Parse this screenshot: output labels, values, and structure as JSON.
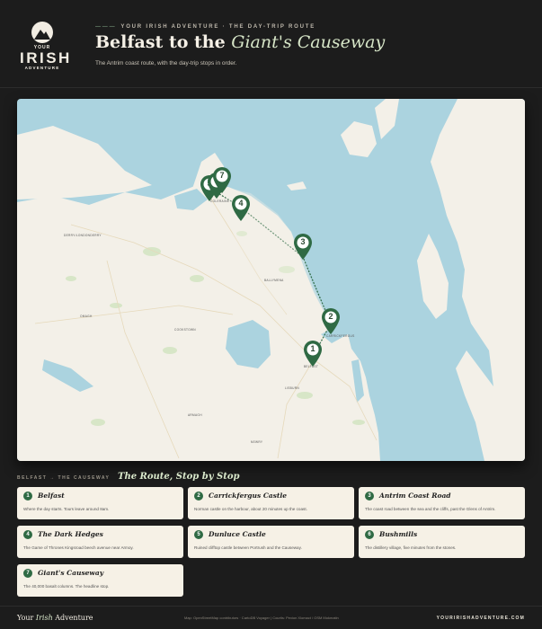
{
  "brand": {
    "your": "YOUR",
    "irish": "IRISH",
    "adventure": "ADVENTURE"
  },
  "header": {
    "kicker": "YOUR IRISH ADVENTURE · THE DAY-TRIP ROUTE",
    "title_prefix": "Belfast to the ",
    "title_emphasis": "Giant's Causeway",
    "subtitle": "The Antrim coast route, with the day-trip stops in order."
  },
  "map": {
    "place_labels": [
      "DERRY/LONDONDERRY",
      "BELFAST",
      "LISBURN",
      "CARRICKFERGUS",
      "COLERAINE",
      "BALLYMENA",
      "OMAGH",
      "ARMAGH",
      "NEWRY",
      "COOKSTOWN"
    ],
    "pins": [
      "1",
      "2",
      "3",
      "4",
      "5",
      "6",
      "7"
    ],
    "colors": {
      "route": "#2f6a44",
      "pin": "#2f6a44",
      "sea": "#abd3df",
      "land": "#f3f0e8"
    }
  },
  "route": {
    "kicker": "BELFAST → THE CAUSEWAY",
    "title": "The Route, Stop by Stop",
    "stops": [
      {
        "num": "1",
        "name": "Belfast",
        "desc": "Where the day starts. Tours leave around 8am."
      },
      {
        "num": "2",
        "name": "Carrickfergus Castle",
        "desc": "Norman castle on the harbour, about 20 minutes up the coast."
      },
      {
        "num": "3",
        "name": "Antrim Coast Road",
        "desc": "The coast road between the sea and the cliffs, past the Glens of Antrim."
      },
      {
        "num": "4",
        "name": "The Dark Hedges",
        "desc": "The Game of Thrones Kingsroad beech avenue near Armoy."
      },
      {
        "num": "5",
        "name": "Dunluce Castle",
        "desc": "Ruined clifftop castle between Portrush and the Causeway."
      },
      {
        "num": "6",
        "name": "Bushmills",
        "desc": "The distillery village, five minutes from the stones."
      },
      {
        "num": "7",
        "name": "Giant's Causeway",
        "desc": "The 40,000 basalt columns. The headline stop."
      }
    ]
  },
  "footer": {
    "brand_prefix": "Your ",
    "brand_emphasis": "Irish",
    "brand_suffix": " Adventure",
    "credit": "Map: OpenStreetMap contributors · CartoDB Voyager | Courtis: Pexion Xlomact / OSM Mokmatin",
    "url": "YOURIRISHADVENTURE.COM"
  }
}
